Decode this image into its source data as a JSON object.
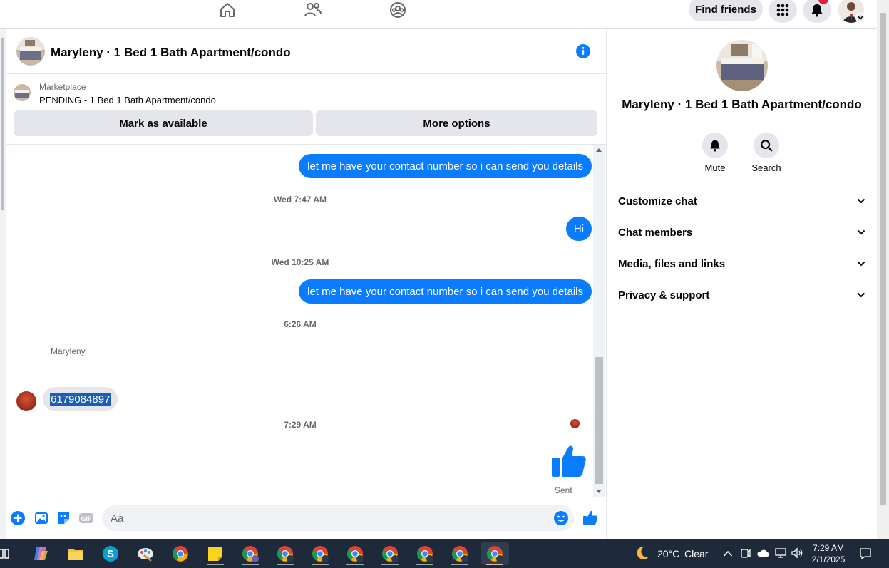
{
  "topnav": {
    "find_friends_label": "Find friends",
    "icons": [
      "home-icon",
      "friends-icon",
      "groups-icon",
      "menu-grid-icon",
      "bell-icon"
    ]
  },
  "chat": {
    "title": "Maryleny · 1 Bed 1 Bath Apartment/condo",
    "marketplace_label": "Marketplace",
    "listing_status": "PENDING - 1 Bed 1 Bath Apartment/condo",
    "mark_available_label": "Mark as available",
    "more_options_label": "More options",
    "messages": {
      "m1": "let me have your contact number so i can send you details",
      "t1": "Wed 7:47 AM",
      "m2": "Hi",
      "t2": "Wed 10:25 AM",
      "m3": "let me have your contact number so i can send you details",
      "t3": "6:26 AM",
      "sender": "Maryleny",
      "m4": "6179084897",
      "t4": "7:29 AM",
      "sent_status": "Sent"
    },
    "composer_placeholder": "Aa"
  },
  "right_panel": {
    "name": "Maryleny · 1 Bed 1 Bath Apartment/condo",
    "mute_label": "Mute",
    "search_label": "Search",
    "sections": [
      "Customize chat",
      "Chat members",
      "Media, files and links",
      "Privacy & support"
    ]
  },
  "taskbar": {
    "weather_temp": "20°C",
    "weather_desc": "Clear",
    "time": "7:29 AM",
    "date": "2/1/2025"
  },
  "colors": {
    "accent": "#0a7cff",
    "bubble_in": "#e4e6eb",
    "taskbar": "#1e2a3a"
  }
}
